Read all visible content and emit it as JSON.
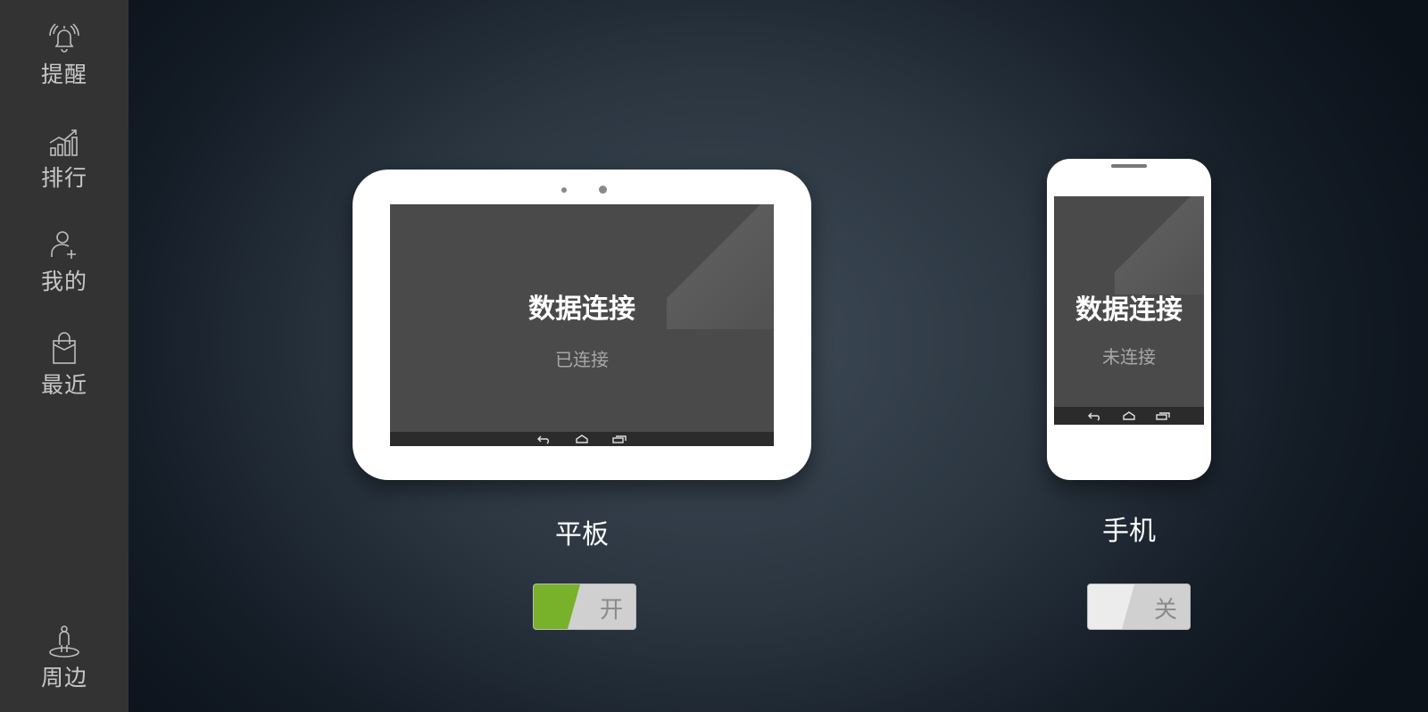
{
  "sidebar": {
    "items": [
      {
        "label": "提醒",
        "icon": "bell-icon"
      },
      {
        "label": "排行",
        "icon": "rank-chart-icon"
      },
      {
        "label": "我的",
        "icon": "user-add-icon"
      },
      {
        "label": "最近",
        "icon": "bag-icon"
      },
      {
        "label": "周边",
        "icon": "location-person-icon"
      }
    ]
  },
  "tablet": {
    "screen_title": "数据连接",
    "screen_status": "已连接",
    "label": "平板",
    "toggle": {
      "state": "on",
      "label": "开",
      "color": "#78b12a"
    }
  },
  "phone": {
    "screen_title": "数据连接",
    "screen_status": "未连接",
    "label": "手机",
    "toggle": {
      "state": "off",
      "label": "关"
    }
  }
}
